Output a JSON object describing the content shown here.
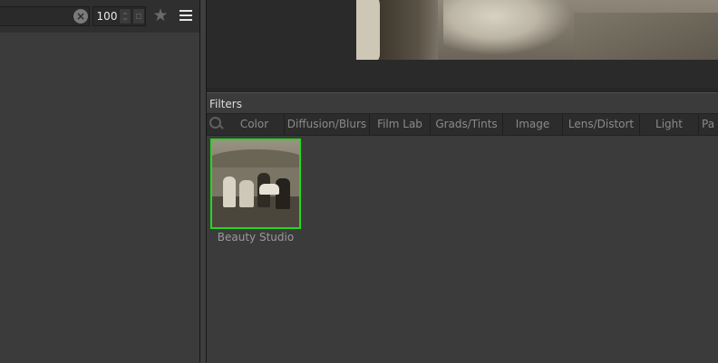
{
  "toolbar": {
    "search_value": "",
    "clear_icon": "clear-icon",
    "opacity_value": "100",
    "star_icon": "star-icon",
    "menu_icon": "hamburger-menu-icon"
  },
  "filters": {
    "title": "Filters",
    "search_icon": "search-icon",
    "categories": [
      "Color",
      "Diffusion/Blurs",
      "Film Lab",
      "Grads/Tints",
      "Image",
      "Lens/Distort",
      "Light",
      "Pa"
    ],
    "items": [
      {
        "label": "Beauty Studio",
        "selected": true
      }
    ]
  },
  "colors": {
    "selection_border": "#27d81c",
    "panel_bg": "#3b3b3b",
    "dark_bg": "#2a2a2a"
  }
}
